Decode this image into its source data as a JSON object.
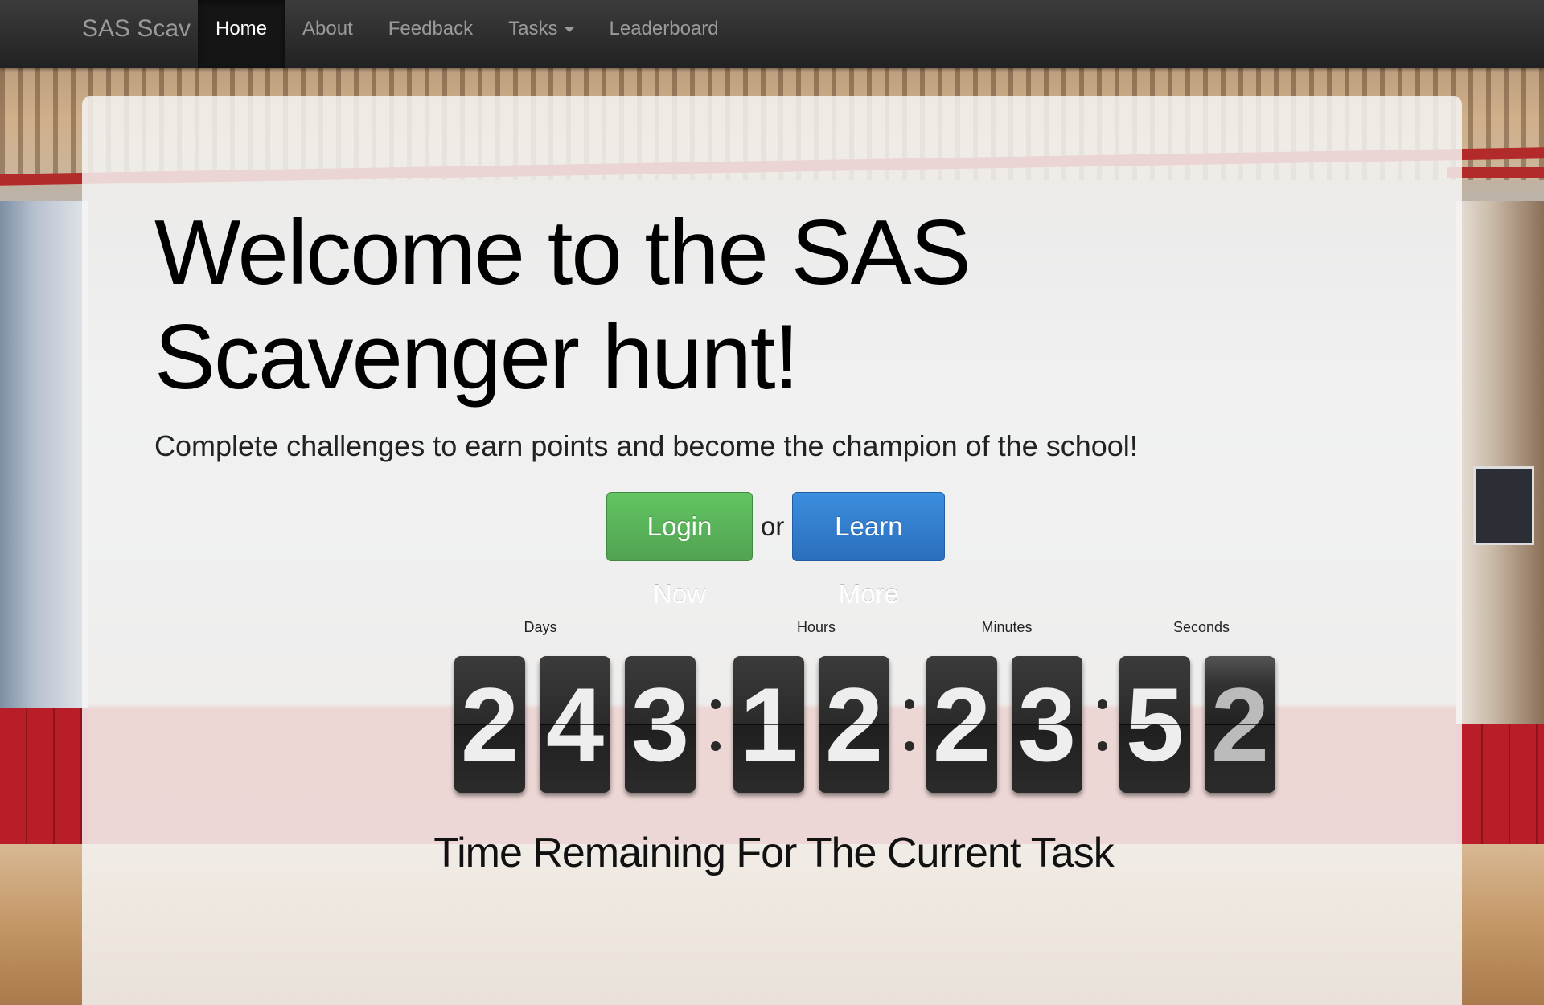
{
  "navbar": {
    "brand": "SAS Scav",
    "items": [
      {
        "label": "Home",
        "active": true
      },
      {
        "label": "About",
        "active": false
      },
      {
        "label": "Feedback",
        "active": false
      },
      {
        "label": "Tasks",
        "active": false,
        "dropdown": true
      },
      {
        "label": "Leaderboard",
        "active": false
      }
    ]
  },
  "hero": {
    "title": "Welcome to the SAS Scavenger hunt!",
    "lead": "Complete challenges to earn points and become the champion of the school!",
    "login_label": "Login Now",
    "or_text": "or",
    "learn_more_label": "Learn More"
  },
  "countdown": {
    "labels": {
      "days": "Days",
      "hours": "Hours",
      "minutes": "Minutes",
      "seconds": "Seconds"
    },
    "days": [
      "2",
      "4",
      "3"
    ],
    "hours": [
      "1",
      "2"
    ],
    "minutes": [
      "2",
      "3"
    ],
    "seconds": [
      "5",
      "2"
    ]
  },
  "caption": "Time Remaining For The Current Task",
  "colors": {
    "navbar": "#222222",
    "success": "#51a351",
    "primary": "#2a6ebd",
    "digit_bg": "#2a2a2a"
  },
  "icons": {
    "tasks_dropdown": "caret-down-icon"
  }
}
